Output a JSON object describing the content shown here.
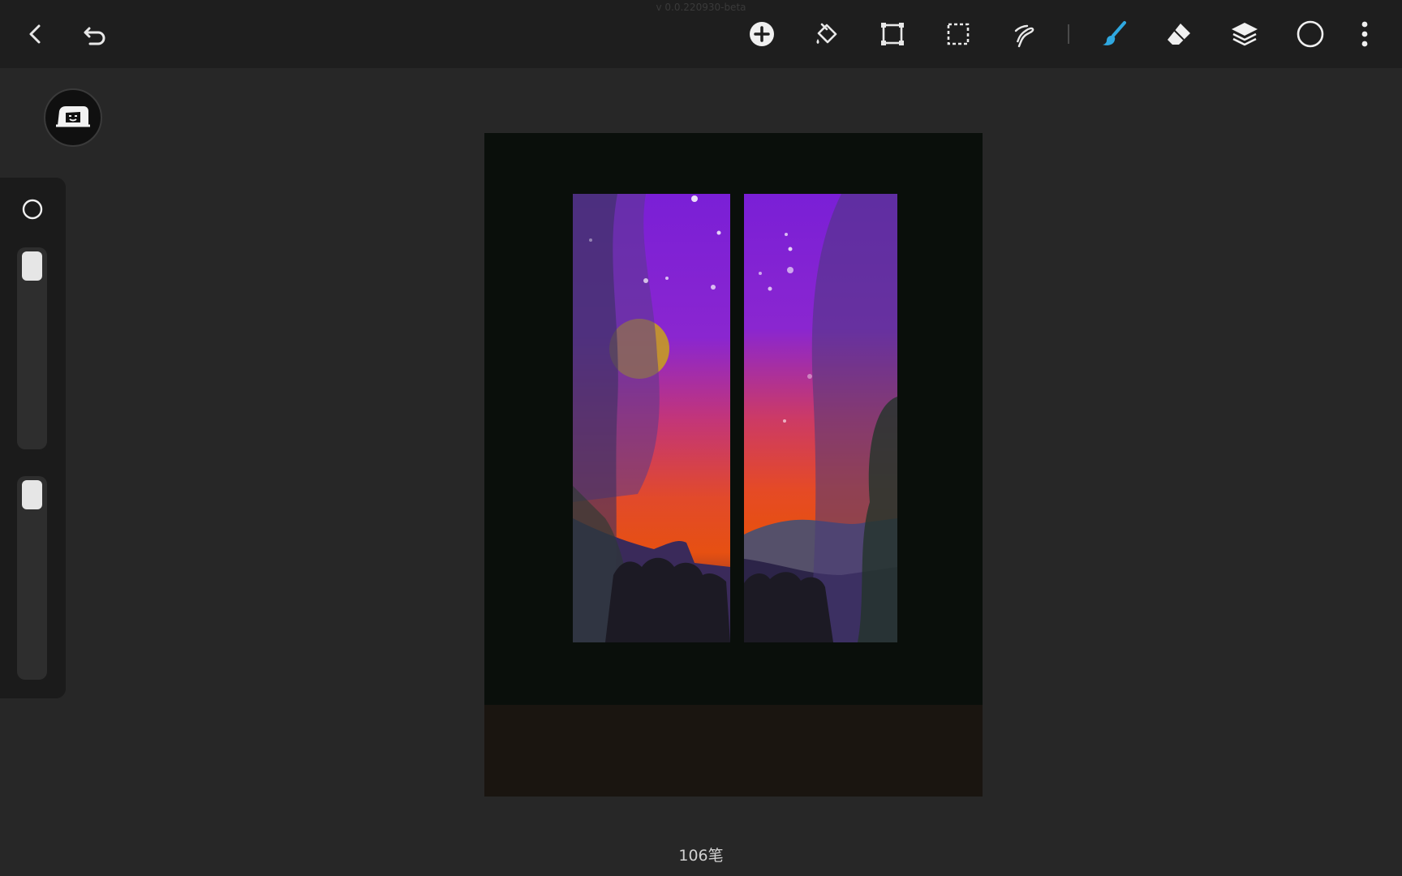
{
  "app": {
    "version_text": "v 0.0.220930-beta"
  },
  "toolbar": {
    "left": [
      {
        "name": "back-button",
        "icon": "chevron-left-icon"
      },
      {
        "name": "undo-button",
        "icon": "undo-icon"
      }
    ],
    "tools": [
      {
        "name": "add-button",
        "icon": "plus-circle-icon"
      },
      {
        "name": "fill-button",
        "icon": "paint-bucket-icon"
      },
      {
        "name": "transform-button",
        "icon": "transform-icon"
      },
      {
        "name": "selection-button",
        "icon": "marquee-select-icon"
      },
      {
        "name": "smudge-button",
        "icon": "smudge-icon"
      },
      {
        "name": "brush-button",
        "icon": "brush-icon",
        "active": true,
        "color": "#2fa8e0"
      },
      {
        "name": "eraser-button",
        "icon": "eraser-icon"
      },
      {
        "name": "layers-button",
        "icon": "layers-icon"
      },
      {
        "name": "color-button",
        "icon": "color-circle-icon"
      },
      {
        "name": "more-button",
        "icon": "more-vertical-icon"
      }
    ]
  },
  "sidebar": {
    "avatar_icon": "profile-avatar-icon",
    "brush_shape_icon": "circle-outline-icon",
    "size_slider": {
      "value": 0.95
    },
    "opacity_slider": {
      "value": 0.95
    }
  },
  "canvas": {
    "stroke_count": "106笔"
  },
  "colors": {
    "topbar": "#1e1e1e",
    "background": "#272727",
    "accent_brush": "#2fa8e0"
  }
}
